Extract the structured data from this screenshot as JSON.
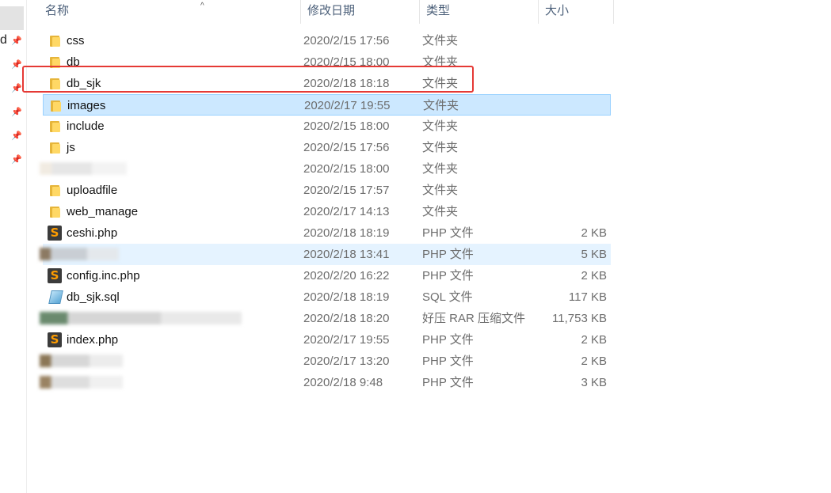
{
  "left_pane": {
    "partial_label": "d"
  },
  "columns": {
    "name": "名称",
    "date": "修改日期",
    "type": "类型",
    "size": "大小"
  },
  "sort_indicator": "^",
  "files": [
    {
      "name": "css",
      "date": "2020/2/15 17:56",
      "type": "文件夹",
      "size": "",
      "icon": "folder-icon"
    },
    {
      "name": "db",
      "date": "2020/2/15 18:00",
      "type": "文件夹",
      "size": "",
      "icon": "folder-icon"
    },
    {
      "name": "db_sjk",
      "date": "2020/2/18 18:18",
      "type": "文件夹",
      "size": "",
      "icon": "folder-icon"
    },
    {
      "name": "images",
      "date": "2020/2/17 19:55",
      "type": "文件夹",
      "size": "",
      "icon": "folder-icon"
    },
    {
      "name": "include",
      "date": "2020/2/15 18:00",
      "type": "文件夹",
      "size": "",
      "icon": "folder-icon"
    },
    {
      "name": "js",
      "date": "2020/2/15 17:56",
      "type": "文件夹",
      "size": "",
      "icon": "folder-icon"
    },
    {
      "name": "",
      "date": "2020/2/15 18:00",
      "type": "文件夹",
      "size": "",
      "icon": "redacted"
    },
    {
      "name": "uploadfile",
      "date": "2020/2/15 17:57",
      "type": "文件夹",
      "size": "",
      "icon": "folder-icon"
    },
    {
      "name": "web_manage",
      "date": "2020/2/17 14:13",
      "type": "文件夹",
      "size": "",
      "icon": "folder-icon"
    },
    {
      "name": "ceshi.php",
      "date": "2020/2/18 18:19",
      "type": "PHP 文件",
      "size": "2 KB",
      "icon": "php-icon"
    },
    {
      "name": "",
      "date": "2020/2/18 13:41",
      "type": "PHP 文件",
      "size": "5 KB",
      "icon": "redacted"
    },
    {
      "name": "config.inc.php",
      "date": "2020/2/20 16:22",
      "type": "PHP 文件",
      "size": "2 KB",
      "icon": "php-icon"
    },
    {
      "name": "db_sjk.sql",
      "date": "2020/2/18 18:19",
      "type": "SQL 文件",
      "size": "117 KB",
      "icon": "sql-icon"
    },
    {
      "name": "",
      "date": "2020/2/18 18:20",
      "type": "好压 RAR 压缩文件",
      "size": "11,753 KB",
      "icon": "redacted"
    },
    {
      "name": "index.php",
      "date": "2020/2/17 19:55",
      "type": "PHP 文件",
      "size": "2 KB",
      "icon": "php-icon"
    },
    {
      "name": "",
      "date": "2020/2/17 13:20",
      "type": "PHP 文件",
      "size": "2 KB",
      "icon": "redacted"
    },
    {
      "name": "",
      "date": "2020/2/18 9:48",
      "type": "PHP 文件",
      "size": "3 KB",
      "icon": "redacted"
    }
  ],
  "selected_row": "images",
  "hover_row_index": 10,
  "highlighted_row": "db_sjk",
  "colors": {
    "selection": "#cce8ff",
    "hover": "#e5f3ff",
    "annotation_box": "#e53935",
    "header_text": "#4c607a"
  }
}
